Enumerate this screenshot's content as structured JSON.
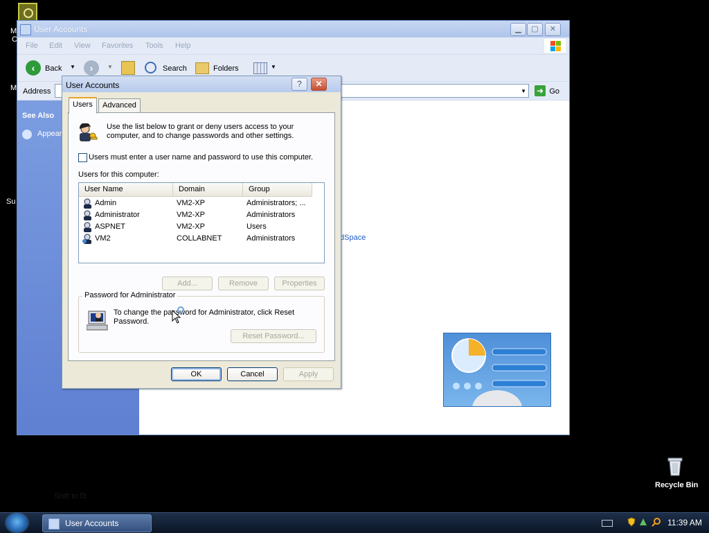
{
  "desktop": {
    "left_fragments": [
      "M",
      "C",
      "M",
      "Su"
    ],
    "ghost_text": "Shift to f3",
    "recycle_bin_label": "Recycle Bin"
  },
  "explorer": {
    "title": "User Accounts",
    "menu": [
      "File",
      "Edit",
      "View",
      "Favorites",
      "Tools",
      "Help"
    ],
    "toolbar": {
      "back": "Back",
      "search": "Search",
      "folders": "Folders"
    },
    "address_label": "Address",
    "go_label": "Go",
    "see_also": "See Also",
    "see_also_item": "Appear",
    "link_fragment": "dSpace"
  },
  "dialog": {
    "title": "User Accounts",
    "help_glyph": "?",
    "close_glyph": "✕",
    "tabs": [
      {
        "label": "Users"
      },
      {
        "label": "Advanced"
      }
    ],
    "intro": "Use the list below to grant or deny users access to your computer, and to change passwords and other settings.",
    "require_login_label": "Users must enter a user name and password to use this computer.",
    "require_login_checked": false,
    "users_label": "Users for this computer:",
    "columns": [
      "User Name",
      "Domain",
      "Group"
    ],
    "users": [
      {
        "name": "Admin",
        "domain": "VM2-XP",
        "group": "Administrators; ..."
      },
      {
        "name": "Administrator",
        "domain": "VM2-XP",
        "group": "Administrators"
      },
      {
        "name": "ASPNET",
        "domain": "VM2-XP",
        "group": "Users"
      },
      {
        "name": "VM2",
        "domain": "COLLABNET",
        "group": "Administrators"
      }
    ],
    "buttons": {
      "add": "Add...",
      "remove": "Remove",
      "properties": "Properties"
    },
    "password_group_title": "Password for Administrator",
    "password_text": "To change the password for Administrator, click Reset Password.",
    "reset_password": "Reset Password...",
    "footer": {
      "ok": "OK",
      "cancel": "Cancel",
      "apply": "Apply"
    }
  },
  "taskbar": {
    "task_label": "User Accounts",
    "clock": "11:39 AM"
  },
  "colors": {
    "left_pane": "#6f8fd8",
    "taskbar": "#16243a",
    "dialog_face": "#ece9d8",
    "link": "#215dc6"
  },
  "icons": [
    "users-icon",
    "computer-icon",
    "user-icon",
    "recycle-bin-icon",
    "start-orb-icon",
    "shield-icon",
    "search-icon",
    "back-icon",
    "forward-icon",
    "up-folder-icon",
    "folders-icon",
    "views-icon",
    "go-icon"
  ]
}
